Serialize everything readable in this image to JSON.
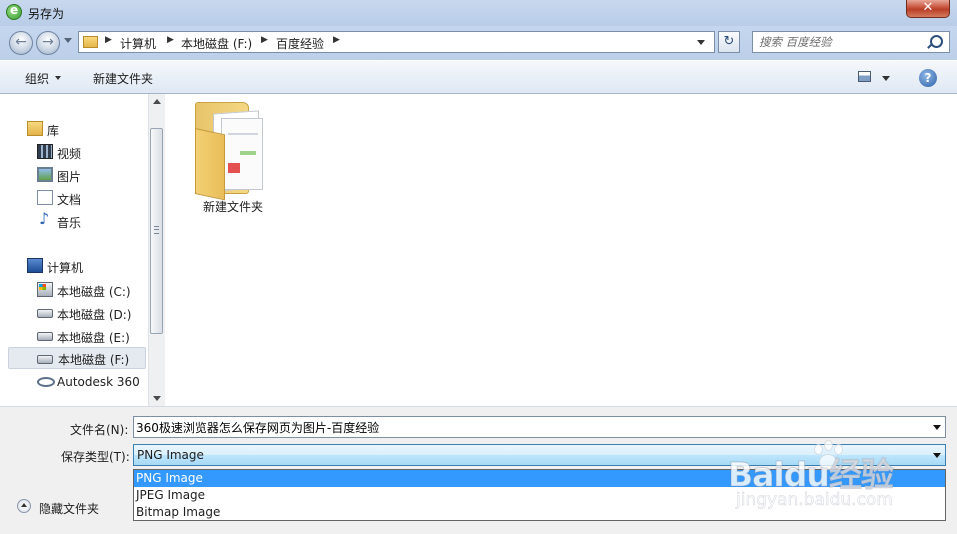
{
  "window": {
    "title": "另存为",
    "close_glyph": "✕"
  },
  "address": {
    "crumbs": [
      "计算机",
      "本地磁盘 (F:)",
      "百度经验"
    ],
    "search_placeholder": "搜索 百度经验"
  },
  "toolbar": {
    "organize": "组织",
    "new_folder": "新建文件夹",
    "help": "?"
  },
  "nav": {
    "libraries": "库",
    "lib_items": [
      "视频",
      "图片",
      "文档",
      "音乐"
    ],
    "computer": "计算机",
    "drives": [
      "本地磁盘 (C:)",
      "本地磁盘 (D:)",
      "本地磁盘 (E:)",
      "本地磁盘 (F:)"
    ],
    "autodesk": "Autodesk 360",
    "selected": "本地磁盘 (F:)"
  },
  "content": {
    "items": [
      {
        "name": "新建文件夹",
        "type": "folder"
      }
    ]
  },
  "form": {
    "filename_label": "文件名(N):",
    "filename_value": "360极速浏览器怎么保存网页为图片-百度经验",
    "filetype_label": "保存类型(T):",
    "filetype_value": "PNG Image",
    "filetype_options": [
      "PNG Image",
      "JPEG Image",
      "Bitmap Image"
    ],
    "hide_folders": "隐藏文件夹"
  },
  "watermark": {
    "logo": "Baidu经验",
    "url": "jingyan.baidu.com"
  }
}
